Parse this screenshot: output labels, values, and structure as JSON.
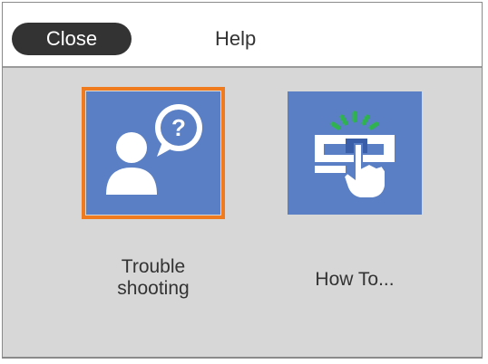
{
  "header": {
    "close_label": "Close",
    "title": "Help"
  },
  "tiles": [
    {
      "label_line1": "Trouble",
      "label_line2": "shooting",
      "icon": "person-question-icon",
      "selected": true
    },
    {
      "label": "How To...",
      "icon": "hand-press-button-icon",
      "selected": false
    }
  ],
  "colors": {
    "tile_blue": "#5a7fc4",
    "selection_orange": "#f07a1e",
    "background_gray": "#d7d7d7",
    "close_button": "#333333",
    "accent_green": "#2fb24f"
  }
}
